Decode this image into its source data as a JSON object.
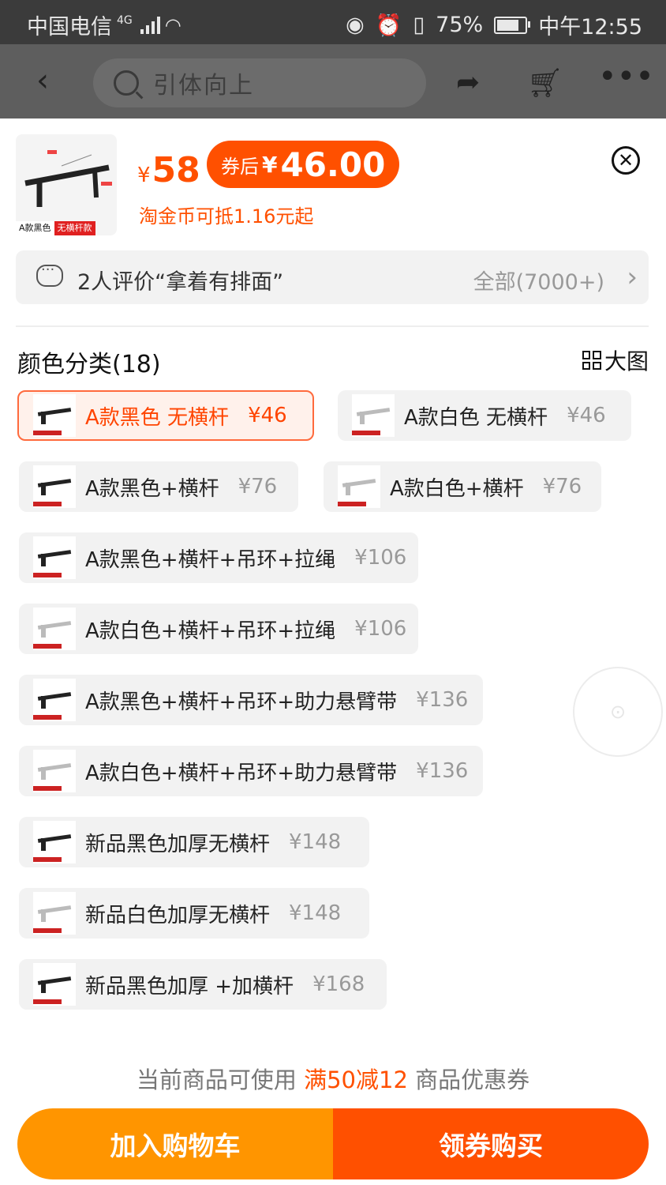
{
  "status": {
    "carrier": "中国电信",
    "network": "4G",
    "battery": "75%",
    "time": "中午12:55"
  },
  "header": {
    "search_text": "引体向上"
  },
  "product": {
    "thumb_tag": "A款黑色",
    "thumb_tag2": "无横杆款",
    "price_symbol": "¥",
    "price": "58",
    "coupon_label": "券后",
    "coupon_symbol": "¥",
    "coupon_price": "46.00",
    "coins": "淘金币可抵1.16元起"
  },
  "review": {
    "text": "2人评价“拿着有排面”",
    "all": "全部(7000+)"
  },
  "section": {
    "title": "颜色分类(18)",
    "big_pic": "大图"
  },
  "options": [
    {
      "name": "A款黑色 无横杆",
      "price": "¥46",
      "selected": true,
      "color": "black"
    },
    {
      "name": "A款白色 无横杆",
      "price": "¥46",
      "color": "white"
    },
    {
      "name": "A款黑色+横杆",
      "price": "¥76",
      "color": "black"
    },
    {
      "name": "A款白色+横杆",
      "price": "¥76",
      "color": "white"
    },
    {
      "name": "A款黑色+横杆+吊环+拉绳",
      "price": "¥106",
      "color": "black"
    },
    {
      "name": "A款白色+横杆+吊环+拉绳",
      "price": "¥106",
      "color": "white"
    },
    {
      "name": "A款黑色+横杆+吊环+助力悬臂带",
      "price": "¥136",
      "color": "black"
    },
    {
      "name": "A款白色+横杆+吊环+助力悬臂带",
      "price": "¥136",
      "color": "white"
    },
    {
      "name": "新品黑色加厚无横杆",
      "price": "¥148",
      "color": "black"
    },
    {
      "name": "新品白色加厚无横杆",
      "price": "¥148",
      "color": "white"
    },
    {
      "name": "新品黑色加厚 +加横杆",
      "price": "¥168",
      "color": "black"
    }
  ],
  "footer": {
    "note_prefix": "当前商品可使用",
    "note_highlight": "满50减12",
    "note_suffix": "商品优惠券",
    "add_cart": "加入购物车",
    "buy": "领券购买"
  },
  "colors": {
    "accent": "#ff5000",
    "cart_button": "#ff9500"
  }
}
